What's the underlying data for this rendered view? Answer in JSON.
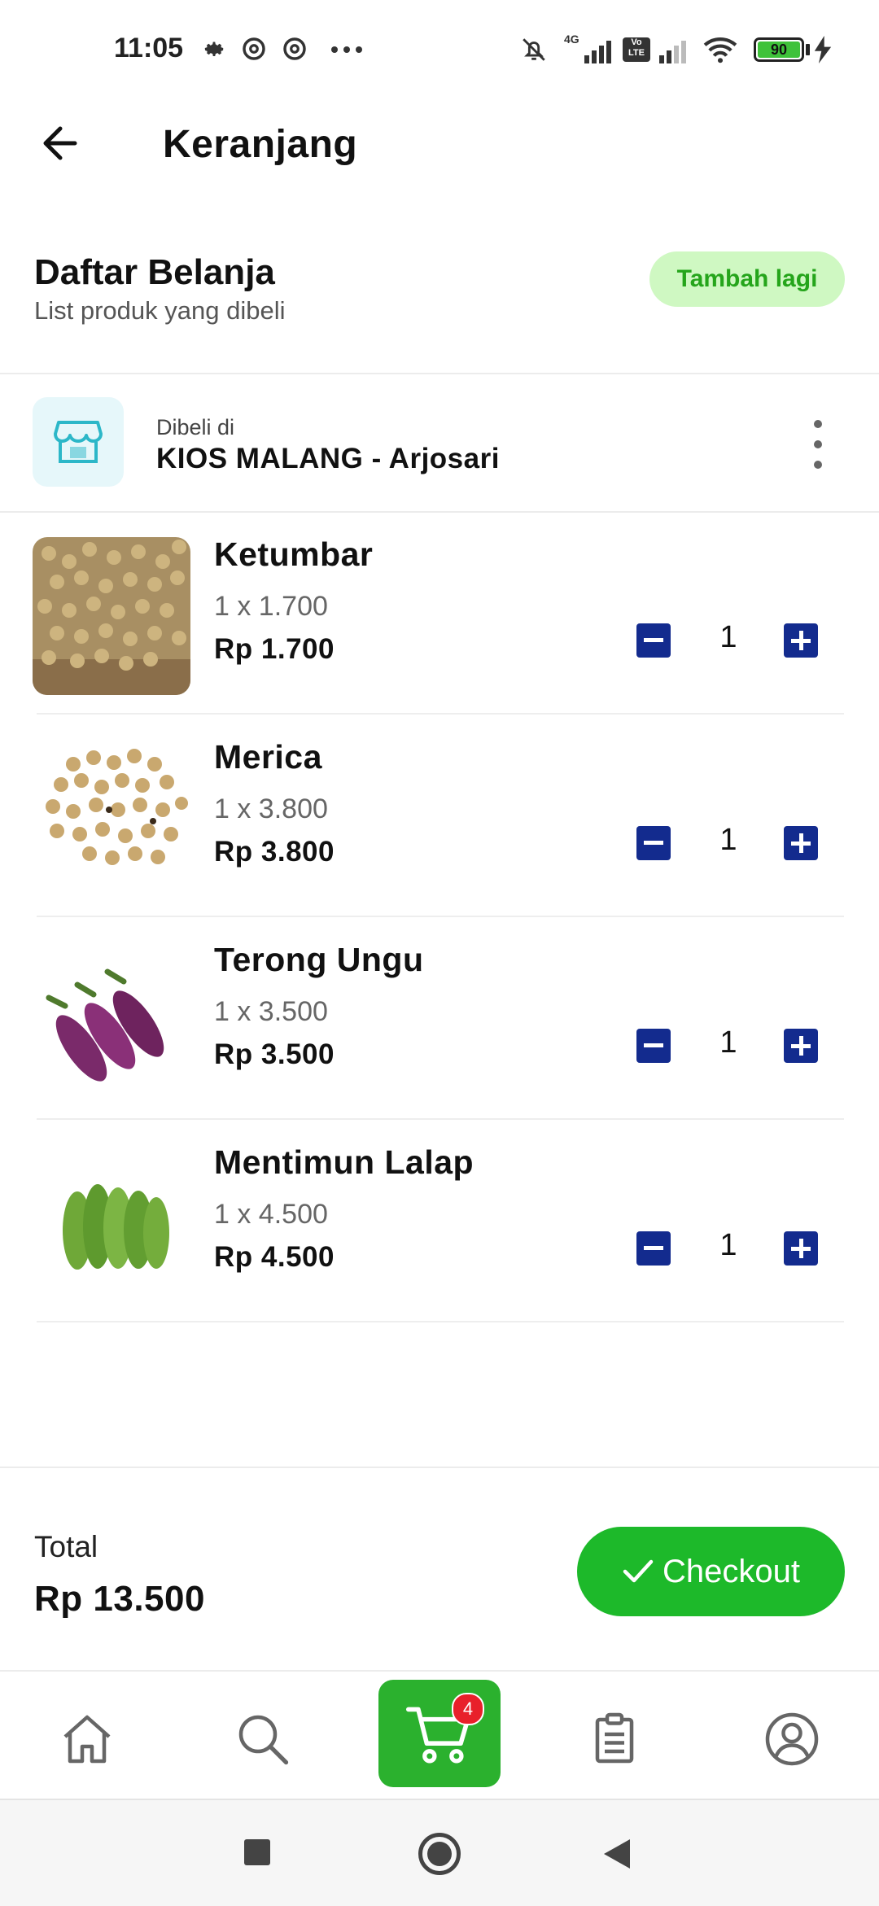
{
  "status_bar": {
    "time": "11:05",
    "battery": "90",
    "network": "4G",
    "volte": "Vo LTE",
    "icons": [
      "settings-icon",
      "dnd-icon",
      "dnd-icon",
      "more-icon",
      "mute-icon",
      "signal-icon",
      "signal-icon",
      "wifi-icon",
      "battery-icon",
      "charging-icon"
    ]
  },
  "header": {
    "title": "Keranjang",
    "back_icon": "arrow-left-icon"
  },
  "section": {
    "title": "Daftar Belanja",
    "subtitle": "List produk yang dibeli",
    "add_button": "Tambah lagi"
  },
  "store": {
    "label": "Dibeli di",
    "name": "KIOS MALANG - Arjosari",
    "icon": "store-icon"
  },
  "items": [
    {
      "name": "Ketumbar",
      "qty_line": "1 x 1.700",
      "price": "Rp 1.700",
      "quantity": "1"
    },
    {
      "name": "Merica",
      "qty_line": "1 x 3.800",
      "price": "Rp 3.800",
      "quantity": "1"
    },
    {
      "name": "Terong Ungu",
      "qty_line": "1 x 3.500",
      "price": "Rp 3.500",
      "quantity": "1"
    },
    {
      "name": "Mentimun Lalap",
      "qty_line": "1 x 4.500",
      "price": "Rp 4.500",
      "quantity": "1"
    }
  ],
  "summary": {
    "total_label": "Total",
    "total_value": "Rp 13.500",
    "checkout_label": "Checkout"
  },
  "bottom_nav": {
    "items": [
      "home-icon",
      "search-icon",
      "cart-icon",
      "orders-icon",
      "profile-icon"
    ],
    "active": "cart",
    "cart_badge": "4"
  },
  "colors": {
    "primary_green": "#1db92a",
    "light_green": "#cff8c2",
    "stepper_blue": "#132b8e",
    "badge_red": "#e8202a"
  }
}
